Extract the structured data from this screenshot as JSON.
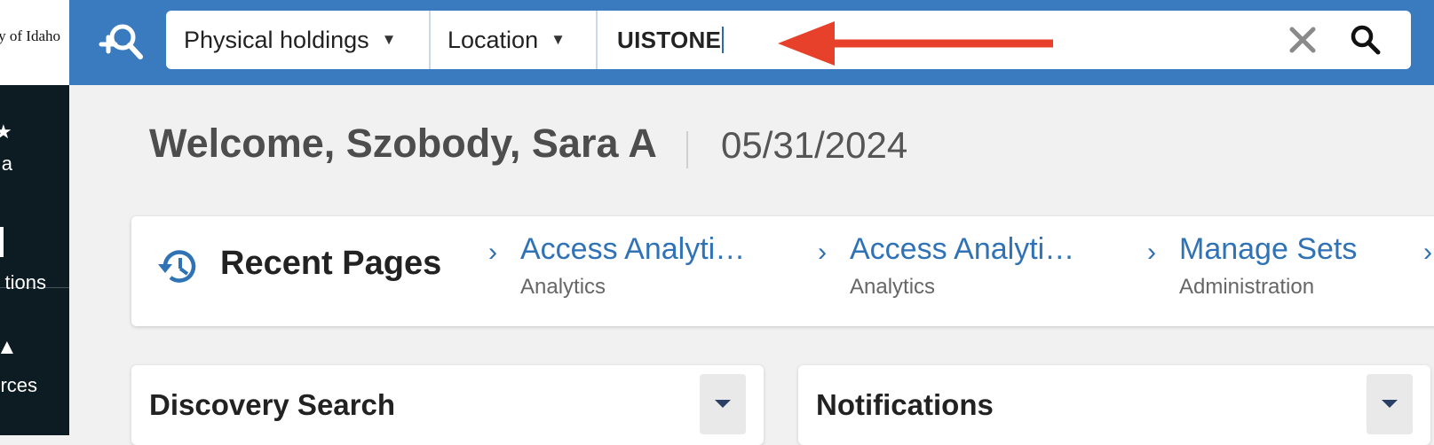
{
  "header": {
    "logo_text": "ity of Idaho",
    "search_scope": "Physical holdings",
    "search_field": "Location",
    "search_query": "UISTONE"
  },
  "sidenav": {
    "items": [
      {
        "label": "a",
        "icon": "star-icon"
      },
      {
        "label": "tions",
        "icon": "chart-icon"
      },
      {
        "label": "rces",
        "icon": "book-icon"
      }
    ]
  },
  "welcome": {
    "greeting": "Welcome, Szobody, Sara A",
    "date": "05/31/2024"
  },
  "recent_pages": {
    "title": "Recent Pages",
    "items": [
      {
        "title": "Access Analyti…",
        "subtitle": "Analytics"
      },
      {
        "title": "Access Analyti…",
        "subtitle": "Analytics"
      },
      {
        "title": "Manage Sets",
        "subtitle": "Administration"
      }
    ]
  },
  "widgets": {
    "discovery_title": "Discovery Search",
    "notifications_title": "Notifications"
  },
  "colors": {
    "topbar": "#3a7bbf",
    "sidenav": "#0d1b22",
    "link": "#2f72b5",
    "annotation_arrow": "#e8412b"
  }
}
